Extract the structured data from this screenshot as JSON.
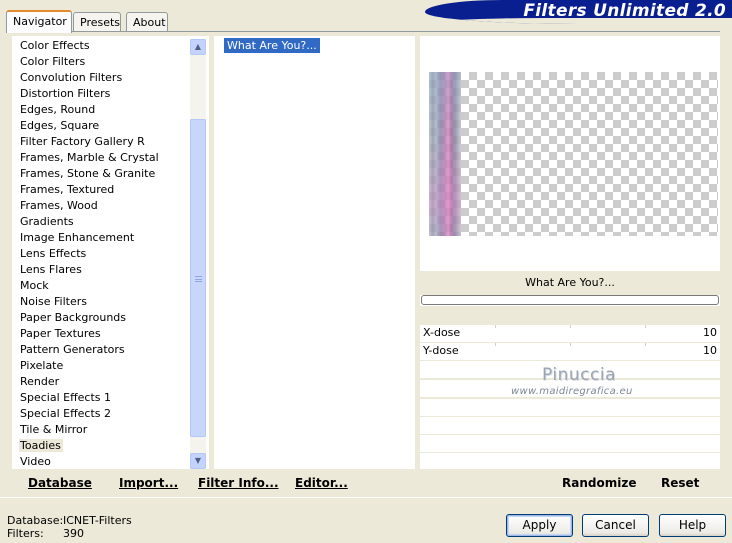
{
  "tabs": [
    {
      "label": "Navigator",
      "active": true
    },
    {
      "label": "Presets",
      "active": false
    },
    {
      "label": "About",
      "active": false
    }
  ],
  "banner": {
    "title": "Filters Unlimited 2.0"
  },
  "categories": {
    "items": [
      "Color Effects",
      "Color Filters",
      "Convolution Filters",
      "Distortion Filters",
      "Edges, Round",
      "Edges, Square",
      "Filter Factory Gallery R",
      "Frames, Marble & Crystal",
      "Frames, Stone & Granite",
      "Frames, Textured",
      "Frames, Wood",
      "Gradients",
      "Image Enhancement",
      "Lens Effects",
      "Lens Flares",
      "Mock",
      "Noise Filters",
      "Paper Backgrounds",
      "Paper Textures",
      "Pattern Generators",
      "Pixelate",
      "Render",
      "Special Effects 1",
      "Special Effects 2",
      "Tile & Mirror",
      "Toadies",
      "Video"
    ],
    "selected": "Toadies"
  },
  "filters": {
    "items": [
      "What Are You?..."
    ],
    "selected": "What Are You?..."
  },
  "preview": {
    "filter_name": "What Are You?...",
    "progress": 0
  },
  "params": [
    {
      "label": "X-dose",
      "value": "10"
    },
    {
      "label": "Y-dose",
      "value": "10"
    }
  ],
  "watermark": {
    "name": "Pinuccia",
    "url": "www.maidiregrafica.eu"
  },
  "toolbar_left": {
    "database": "Database",
    "import": "Import...",
    "filter_info": "Filter Info...",
    "editor": "Editor..."
  },
  "toolbar_right": {
    "randomize": "Randomize",
    "reset": "Reset"
  },
  "status": {
    "database_label": "Database:",
    "database_value": "ICNET-Filters",
    "filters_label": "Filters:",
    "filters_value": "390"
  },
  "buttons": {
    "apply": "Apply",
    "cancel": "Cancel",
    "help": "Help"
  },
  "colors": {
    "selection": "#316ac5",
    "banner": "#0a1f8f",
    "dialog_bg": "#ece9d8"
  }
}
